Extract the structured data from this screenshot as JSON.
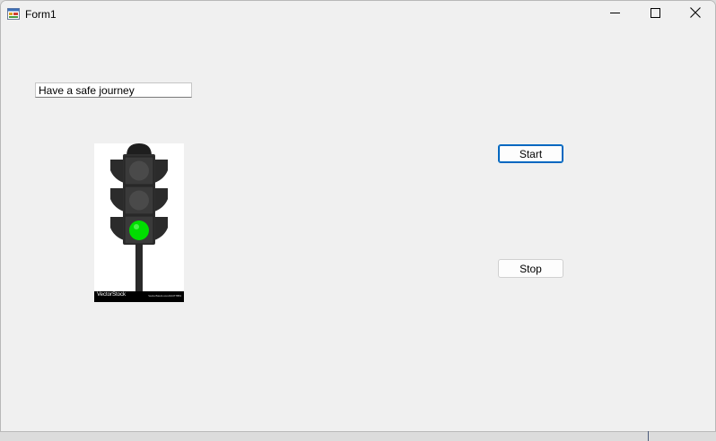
{
  "window": {
    "title": "Form1",
    "app_icon": "winforms-app-icon",
    "controls": {
      "minimize_icon": "minimize-icon",
      "maximize_icon": "maximize-icon",
      "close_icon": "close-icon"
    }
  },
  "message_box": {
    "value": "Have a safe journey"
  },
  "traffic_light": {
    "image": "traffic-light-image",
    "active_light": "green",
    "colors": {
      "green": "#00dd00",
      "off": "#4a4a4a",
      "housing": "#2f2f2f"
    },
    "watermark_left": "VectorStock",
    "watermark_right": "VectorStock.com/24477853"
  },
  "buttons": {
    "start_label": "Start",
    "stop_label": "Stop"
  },
  "colors": {
    "form_background": "#f0f0f0",
    "focus_accent": "#0067c0"
  }
}
